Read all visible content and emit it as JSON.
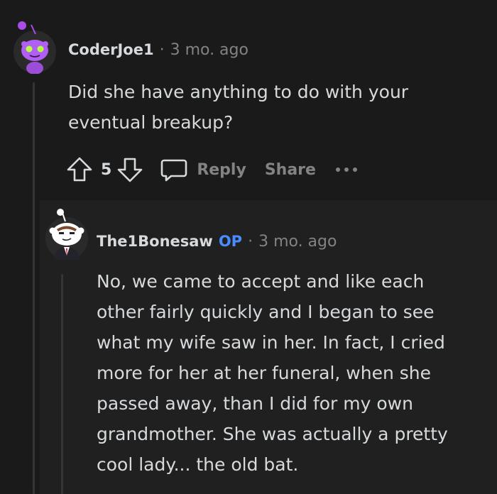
{
  "comments": [
    {
      "avatar": "snoo-avatar-purple",
      "username": "CoderJoe1",
      "separator": "·",
      "timestamp": "3 mo. ago",
      "body_lines": [
        "Did she have anything to do with your",
        "eventual breakup?"
      ],
      "votes": "5",
      "actions": {
        "reply": "Reply",
        "share": "Share",
        "more": "..."
      }
    },
    {
      "avatar": "snoo-avatar-suit",
      "username": "The1Bonesaw",
      "op_badge": "OP",
      "separator": "·",
      "timestamp": "3 mo. ago",
      "body_lines": [
        "No, we came to accept and like each",
        "other fairly quickly and I began to see",
        "what my wife saw in her. In fact, I cried",
        "more for her at her funeral, when she",
        "passed away, than I did for my own",
        "grandmother. She was actually a pretty",
        "cool lady... the old bat."
      ]
    }
  ],
  "colors": {
    "background": "#1a1a1b",
    "text": "#d7dadc",
    "meta": "#818384",
    "op": "#4a8cff"
  }
}
